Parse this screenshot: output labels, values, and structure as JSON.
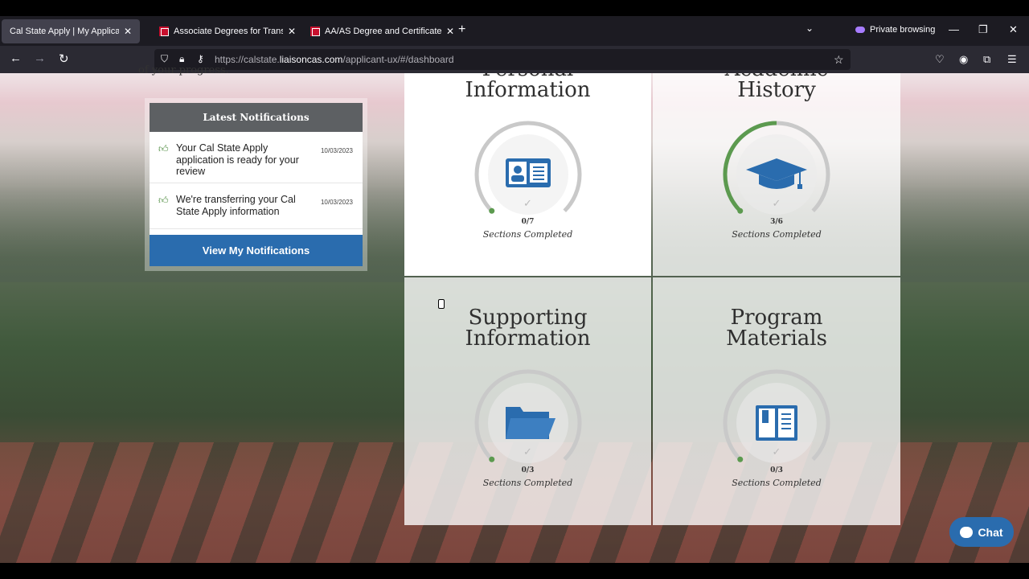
{
  "browser": {
    "tabs": [
      {
        "title": "Cal State Apply | My Application Da",
        "active": true
      },
      {
        "title": "Associate Degrees for Transfer",
        "active": false
      },
      {
        "title": "AA/AS Degree and Certificate P",
        "active": false
      }
    ],
    "private_label": "Private browsing",
    "url_prefix": "https://calstate.",
    "url_domain": "liaisoncas.com",
    "url_path": "/applicant-ux/#/dashboard"
  },
  "page": {
    "progress_text": "of your progress.",
    "notifications": {
      "title": "Latest Notifications",
      "items": [
        {
          "text": "Your Cal State Apply application is ready for your review",
          "date": "10/03/2023"
        },
        {
          "text": "We're transferring your Cal State Apply information",
          "date": "10/03/2023"
        }
      ],
      "button_label": "View My Notifications"
    },
    "cards": [
      {
        "title_line1": "Personal",
        "title_line2": "Information",
        "count": "0/7",
        "completed": 0,
        "total": 7,
        "icon": "id-card-icon",
        "sub": "Sections Completed"
      },
      {
        "title_line1": "Academic",
        "title_line2": "History",
        "count": "3/6",
        "completed": 3,
        "total": 6,
        "icon": "graduation-cap-icon",
        "sub": "Sections Completed"
      },
      {
        "title_line1": "Supporting",
        "title_line2": "Information",
        "count": "0/3",
        "completed": 0,
        "total": 3,
        "icon": "folder-icon",
        "sub": "Sections Completed"
      },
      {
        "title_line1": "Program",
        "title_line2": "Materials",
        "count": "0/3",
        "completed": 0,
        "total": 3,
        "icon": "book-icon",
        "sub": "Sections Completed"
      }
    ],
    "chat_label": "Chat"
  },
  "colors": {
    "accent": "#2a6cae",
    "progress": "#5c9a4f",
    "ring": "#c9c9c9",
    "icon": "#2a6cae"
  }
}
